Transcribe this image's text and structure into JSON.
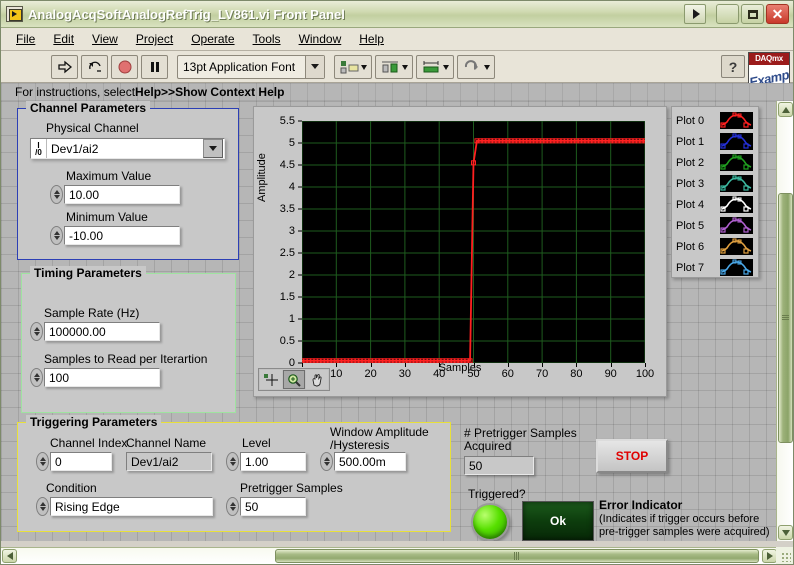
{
  "window": {
    "title": "AnalogAcqSoftAnalogRefTrig_LV861.vi Front Panel",
    "run_button": "▶",
    "minimize": "–",
    "maximize": "□",
    "close": "✕"
  },
  "menu": {
    "items": [
      "File",
      "Edit",
      "View",
      "Project",
      "Operate",
      "Tools",
      "Window",
      "Help"
    ]
  },
  "toolbar": {
    "run_icon": "run-arrow-icon",
    "run_continuous_icon": "run-continuous-icon",
    "abort_icon": "abort-execution-icon",
    "pause_icon": "pause-icon",
    "font_selector": "13pt Application Font",
    "align_icon": "align-objects-icon",
    "distribute_icon": "distribute-objects-icon",
    "resize_icon": "resize-objects-icon",
    "reorder_icon": "reorder-objects-icon",
    "help_icon": "?",
    "badge_line1": "DAQmx",
    "badge_line2": "Example"
  },
  "context_help": {
    "prefix": "For instructions, select ",
    "bold": "Help>>Show Context Help"
  },
  "channel_parameters": {
    "title": "Channel Parameters",
    "physical_channel_label": "Physical Channel",
    "physical_channel_value": "Dev1/ai2",
    "io_tag_top": "I",
    "io_tag_bottom": "/0",
    "maximum_label": "Maximum Value",
    "maximum_value": "10.00",
    "minimum_label": "Minimum Value",
    "minimum_value": "-10.00"
  },
  "timing_parameters": {
    "title": "Timing Parameters",
    "sample_rate_label": "Sample Rate (Hz)",
    "sample_rate_value": "100000.00",
    "samples_label": "Samples to Read per Iterartion",
    "samples_value": "100"
  },
  "triggering_parameters": {
    "title": "Triggering Parameters",
    "channel_index_label": "Channel Index",
    "channel_index_value": "0",
    "channel_name_label": "Channel Name",
    "channel_name_value": "Dev1/ai2",
    "level_label": "Level",
    "level_value": "1.00",
    "window_label_line1": "Window Amplitude",
    "window_label_line2": "/Hysteresis",
    "window_value": "500.00m",
    "condition_label": "Condition",
    "condition_value": "Rising Edge",
    "pretrigger_label": "Pretrigger Samples",
    "pretrigger_value": "50"
  },
  "status": {
    "pretrigger_acquired_label_line1": "# Pretrigger Samples",
    "pretrigger_acquired_label_line2": "Acquired",
    "pretrigger_acquired_value": "50",
    "stop_label": "STOP",
    "triggered_label": "Triggered?",
    "error_value": "Ok",
    "error_title": "Error Indicator",
    "error_note_line1": "(Indicates if trigger occurs before",
    "error_note_line2": "pre-trigger samples were acquired)"
  },
  "graph_palette": {
    "cursor_icon": "cursor-crosshair-icon",
    "zoom_icon": "zoom-magnifier-icon",
    "pan_icon": "pan-hand-icon",
    "selected": "zoom"
  },
  "legend": {
    "plots": [
      {
        "label": "Plot 0",
        "color": "#ff2020"
      },
      {
        "label": "Plot 1",
        "color": "#2430d8"
      },
      {
        "label": "Plot 2",
        "color": "#20a020"
      },
      {
        "label": "Plot 3",
        "color": "#3cb8a0"
      },
      {
        "label": "Plot 4",
        "color": "#ffffff"
      },
      {
        "label": "Plot 5",
        "color": "#b060d0"
      },
      {
        "label": "Plot 6",
        "color": "#e0a040"
      },
      {
        "label": "Plot 7",
        "color": "#4aa8e8"
      }
    ]
  },
  "chart_data": {
    "type": "line",
    "title": "",
    "xlabel": "Samples",
    "ylabel": "Amplitude",
    "xlim": [
      0,
      100
    ],
    "ylim": [
      0,
      5.5
    ],
    "xticks": [
      0,
      10,
      20,
      30,
      40,
      50,
      60,
      70,
      80,
      90,
      100
    ],
    "yticks": [
      0,
      0.5,
      1,
      1.5,
      2,
      2.5,
      3,
      3.5,
      4,
      4.5,
      5,
      5.5
    ],
    "ytick_labels": [
      "0",
      "0.5",
      "1",
      "1.5",
      "2",
      "2.5",
      "3",
      "3.5",
      "4",
      "4.5",
      "5",
      "5.5"
    ],
    "grid": true,
    "grid_color": "#1e5c1e",
    "plot_background": "#000000",
    "legend_position": "right",
    "series": [
      {
        "name": "Plot 0",
        "color": "#ff2020",
        "marker": "square",
        "x": [
          0,
          1,
          2,
          3,
          4,
          5,
          6,
          7,
          8,
          9,
          10,
          11,
          12,
          13,
          14,
          15,
          16,
          17,
          18,
          19,
          20,
          21,
          22,
          23,
          24,
          25,
          26,
          27,
          28,
          29,
          30,
          31,
          32,
          33,
          34,
          35,
          36,
          37,
          38,
          39,
          40,
          41,
          42,
          43,
          44,
          45,
          46,
          47,
          48,
          49,
          50,
          51,
          52,
          53,
          54,
          55,
          56,
          57,
          58,
          59,
          60,
          61,
          62,
          63,
          64,
          65,
          66,
          67,
          68,
          69,
          70,
          71,
          72,
          73,
          74,
          75,
          76,
          77,
          78,
          79,
          80,
          81,
          82,
          83,
          84,
          85,
          86,
          87,
          88,
          89,
          90,
          91,
          92,
          93,
          94,
          95,
          96,
          97,
          98,
          99,
          100
        ],
        "y": [
          0.05,
          0.05,
          0.05,
          0.05,
          0.05,
          0.05,
          0.05,
          0.05,
          0.05,
          0.05,
          0.05,
          0.05,
          0.05,
          0.05,
          0.05,
          0.05,
          0.05,
          0.05,
          0.05,
          0.05,
          0.05,
          0.05,
          0.05,
          0.05,
          0.05,
          0.05,
          0.05,
          0.05,
          0.05,
          0.05,
          0.05,
          0.05,
          0.05,
          0.05,
          0.05,
          0.05,
          0.05,
          0.05,
          0.05,
          0.05,
          0.05,
          0.05,
          0.05,
          0.05,
          0.05,
          0.05,
          0.05,
          0.05,
          0.05,
          0.05,
          4.55,
          5.05,
          5.05,
          5.05,
          5.05,
          5.05,
          5.05,
          5.05,
          5.05,
          5.05,
          5.05,
          5.05,
          5.05,
          5.05,
          5.05,
          5.05,
          5.05,
          5.05,
          5.05,
          5.05,
          5.05,
          5.05,
          5.05,
          5.05,
          5.05,
          5.05,
          5.05,
          5.05,
          5.05,
          5.05,
          5.05,
          5.05,
          5.05,
          5.05,
          5.05,
          5.05,
          5.05,
          5.05,
          5.05,
          5.05,
          5.05,
          5.05,
          5.05,
          5.05,
          5.05,
          5.05,
          5.05,
          5.05,
          5.05,
          5.05,
          5.05
        ]
      }
    ]
  }
}
